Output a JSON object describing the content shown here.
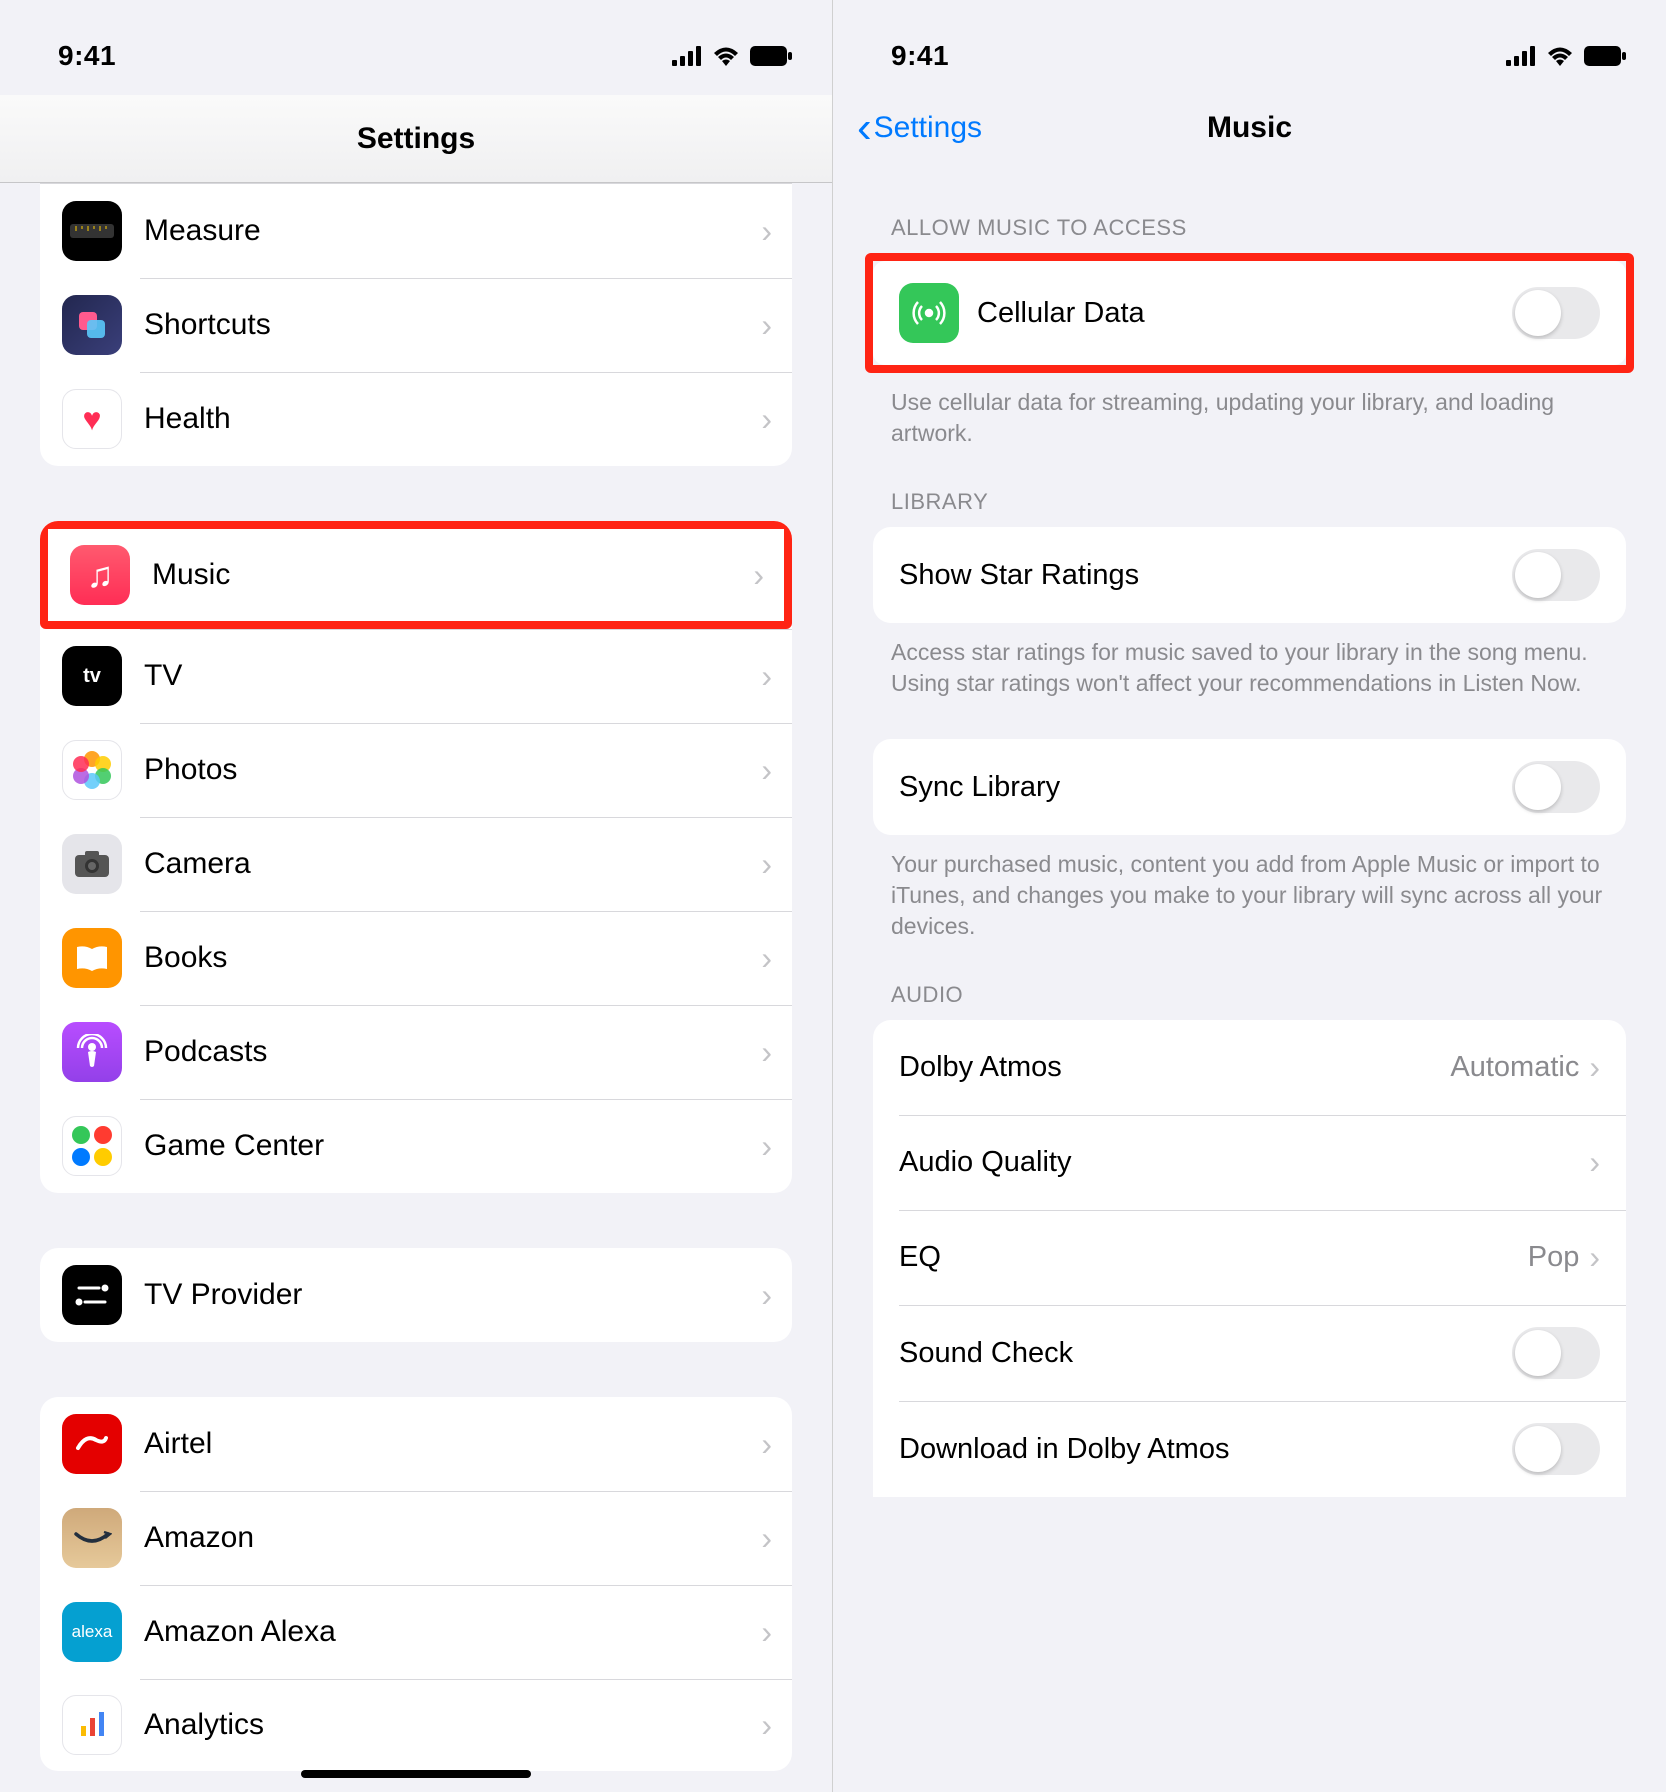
{
  "status": {
    "time": "9:41"
  },
  "left": {
    "title": "Settings",
    "group1": [
      {
        "key": "measure",
        "label": "Measure"
      },
      {
        "key": "shortcuts",
        "label": "Shortcuts"
      },
      {
        "key": "health",
        "label": "Health"
      }
    ],
    "group2": [
      {
        "key": "music",
        "label": "Music",
        "highlighted": true
      },
      {
        "key": "tv",
        "label": "TV"
      },
      {
        "key": "photos",
        "label": "Photos"
      },
      {
        "key": "camera",
        "label": "Camera"
      },
      {
        "key": "books",
        "label": "Books"
      },
      {
        "key": "podcasts",
        "label": "Podcasts"
      },
      {
        "key": "gamecenter",
        "label": "Game Center"
      }
    ],
    "group3": [
      {
        "key": "tvprovider",
        "label": "TV Provider"
      }
    ],
    "group4": [
      {
        "key": "airtel",
        "label": "Airtel"
      },
      {
        "key": "amazon",
        "label": "Amazon"
      },
      {
        "key": "alexa",
        "label": "Amazon Alexa"
      },
      {
        "key": "analytics",
        "label": "Analytics"
      }
    ]
  },
  "right": {
    "back_label": "Settings",
    "title": "Music",
    "sections": {
      "access": {
        "header": "ALLOW MUSIC TO ACCESS",
        "cellular": {
          "label": "Cellular Data",
          "on": false
        },
        "footer": "Use cellular data for streaming, updating your library, and loading artwork."
      },
      "library": {
        "header": "LIBRARY",
        "star": {
          "label": "Show Star Ratings",
          "on": false
        },
        "star_footer": "Access star ratings for music saved to your library in the song menu. Using star ratings won't affect your recommendations in Listen Now.",
        "sync": {
          "label": "Sync Library",
          "on": false
        },
        "sync_footer": "Your purchased music, content you add from Apple Music or import to iTunes, and changes you make to your library will sync across all your devices."
      },
      "audio": {
        "header": "AUDIO",
        "dolby": {
          "label": "Dolby Atmos",
          "value": "Automatic"
        },
        "quality": {
          "label": "Audio Quality"
        },
        "eq": {
          "label": "EQ",
          "value": "Pop"
        },
        "sound_check": {
          "label": "Sound Check",
          "on": false
        },
        "download_dolby": {
          "label": "Download in Dolby Atmos",
          "on": false
        }
      }
    }
  }
}
